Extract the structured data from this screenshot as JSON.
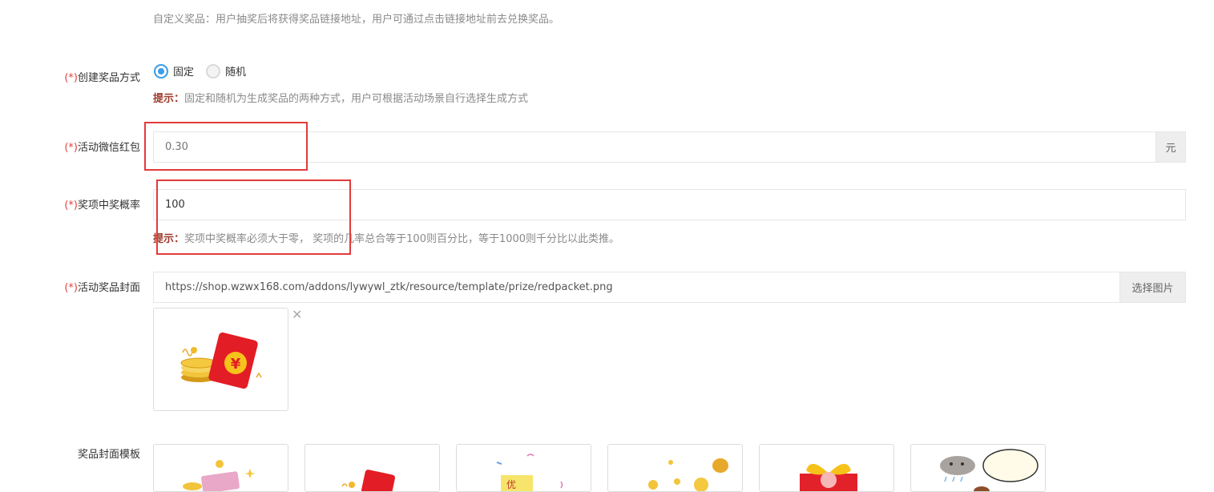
{
  "intro_text": "自定义奖品：用户抽奖后将获得奖品链接地址，用户可通过点击链接地址前去兑换奖品。",
  "required_mark": "(*)",
  "create_mode": {
    "label": "创建奖品方式",
    "options": [
      "固定",
      "随机"
    ],
    "selected": "固定",
    "hint_label": "提示：",
    "hint_text": "固定和随机为生成奖品的两种方式，用户可根据活动场景自行选择生成方式"
  },
  "redpacket": {
    "label": "活动微信红包",
    "placeholder": "0.30",
    "unit": "元"
  },
  "probability": {
    "label": "奖项中奖概率",
    "value": "100",
    "hint_label": "提示：",
    "hint_text": "奖项中奖概率必须大于零， 奖项的几率总合等于100则百分比，等于1000则千分比以此类推。"
  },
  "cover": {
    "label": "活动奖品封面",
    "url": "https://shop.wzwx168.com/addons/lywywl_ztk/resource/template/prize/redpacket.png",
    "select_button": "选择图片",
    "remove_icon": "close-icon",
    "preview_icon": "red-packet-coins"
  },
  "templates": {
    "label": "奖品封面模板",
    "items": [
      "money-stack",
      "red-packet",
      "coupon",
      "gold-coins",
      "gift-box",
      "no-prize"
    ]
  },
  "colors": {
    "accent": "#3d9ee6",
    "required": "#e0453d",
    "highlight_box": "#e23b3b"
  }
}
